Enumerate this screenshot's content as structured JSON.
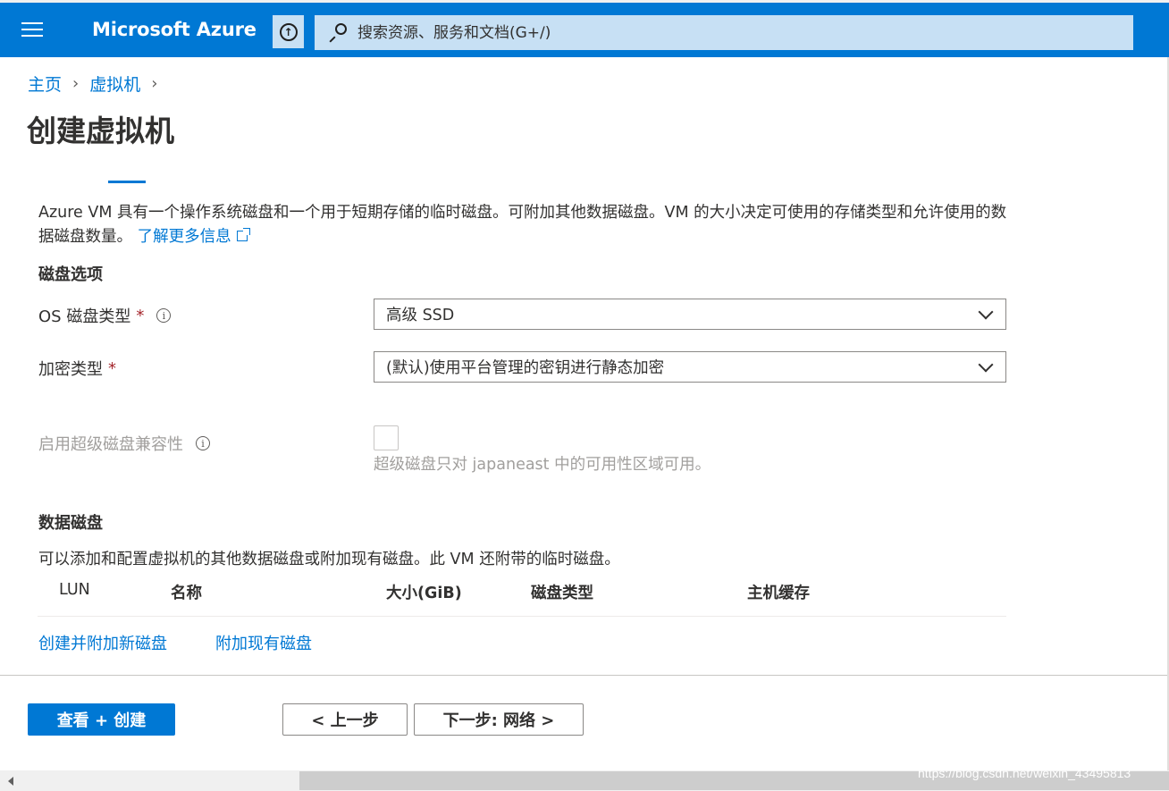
{
  "header": {
    "brand": "Microsoft Azure",
    "upload_icon": "upload-arrow-icon",
    "search_placeholder": "搜索资源、服务和文档(G+/)"
  },
  "breadcrumb": {
    "items": [
      "主页",
      "虚拟机"
    ]
  },
  "page": {
    "title": "创建虚拟机",
    "description": "Azure VM 具有一个操作系统磁盘和一个用于短期存储的临时磁盘。可附加其他数据磁盘。VM 的大小决定可使用的存储类型和允许使用的数据磁盘数量。",
    "learn_more": "了解更多信息"
  },
  "disk_options": {
    "section_title": "磁盘选项",
    "os_disk_type_label": "OS 磁盘类型",
    "os_disk_type_value": "高级 SSD",
    "encryption_label": "加密类型",
    "encryption_value": "(默认)使用平台管理的密钥进行静态加密",
    "ultra_label": "启用超级磁盘兼容性",
    "ultra_hint": "超级磁盘只对 japaneast 中的可用性区域可用。",
    "required_mark": "*"
  },
  "data_disks": {
    "section_title": "数据磁盘",
    "description": "可以添加和配置虚拟机的其他数据磁盘或附加现有磁盘。此 VM 还附带的临时磁盘。",
    "columns": [
      "LUN",
      "名称",
      "大小(GiB)",
      "磁盘类型",
      "主机缓存"
    ],
    "create_link": "创建并附加新磁盘",
    "attach_link": "附加现有磁盘"
  },
  "footer": {
    "review_create": "查看 + 创建",
    "previous": "< 上一步",
    "next": "下一步: 网络 >"
  },
  "watermark": "https://blog.csdn.net/weixin_43495813",
  "colors": {
    "accent": "#0078d4",
    "required": "#a4262c",
    "search_bg": "#c7e0f4"
  }
}
